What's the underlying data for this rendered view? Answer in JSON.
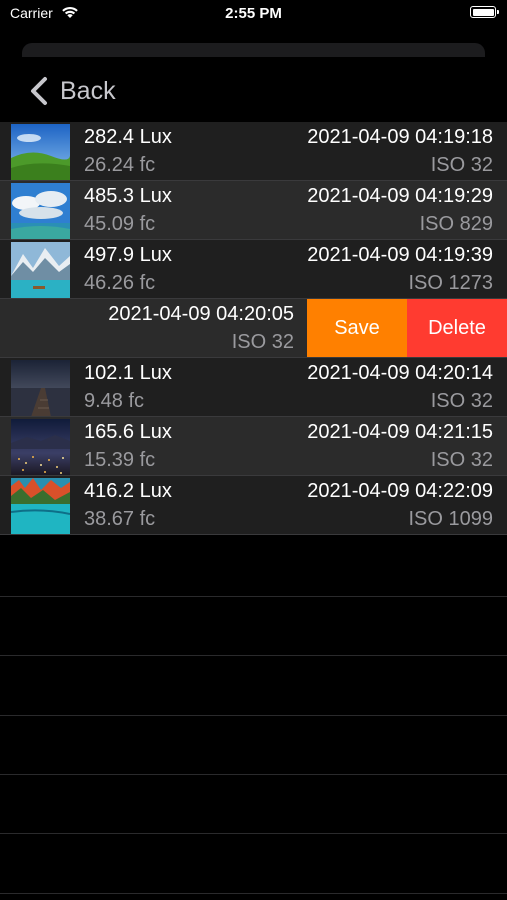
{
  "status_bar": {
    "carrier": "Carrier",
    "time": "2:55 PM"
  },
  "nav": {
    "back_label": "Back"
  },
  "rows": [
    {
      "lux": "282.4 Lux",
      "fc": "26.24 fc",
      "date": "2021-04-09 04:19:18",
      "iso": "ISO 32",
      "thumb": "green-hills"
    },
    {
      "lux": "485.3 Lux",
      "fc": "45.09 fc",
      "date": "2021-04-09 04:19:29",
      "iso": "ISO 829",
      "thumb": "sky-clouds"
    },
    {
      "lux": "497.9 Lux",
      "fc": "46.26 fc",
      "date": "2021-04-09 04:19:39",
      "iso": "ISO 1273",
      "thumb": "mountain-lake"
    },
    {
      "lux": "",
      "fc": "",
      "date": "2021-04-09 04:20:05",
      "iso": "ISO 32",
      "thumb": "",
      "swiped": true
    },
    {
      "lux": "102.1 Lux",
      "fc": "9.48 fc",
      "date": "2021-04-09 04:20:14",
      "iso": "ISO 32",
      "thumb": "pier-dusk"
    },
    {
      "lux": "165.6 Lux",
      "fc": "15.39 fc",
      "date": "2021-04-09 04:21:15",
      "iso": "ISO 32",
      "thumb": "city-night"
    },
    {
      "lux": "416.2 Lux",
      "fc": "38.67 fc",
      "date": "2021-04-09 04:22:09",
      "iso": "ISO 1099",
      "thumb": "autumn-lake"
    }
  ],
  "swipe_actions": {
    "save_label": "Save",
    "delete_label": "Delete"
  },
  "colors": {
    "save": "#ff8000",
    "delete": "#ff3b30",
    "background": "#000000"
  }
}
